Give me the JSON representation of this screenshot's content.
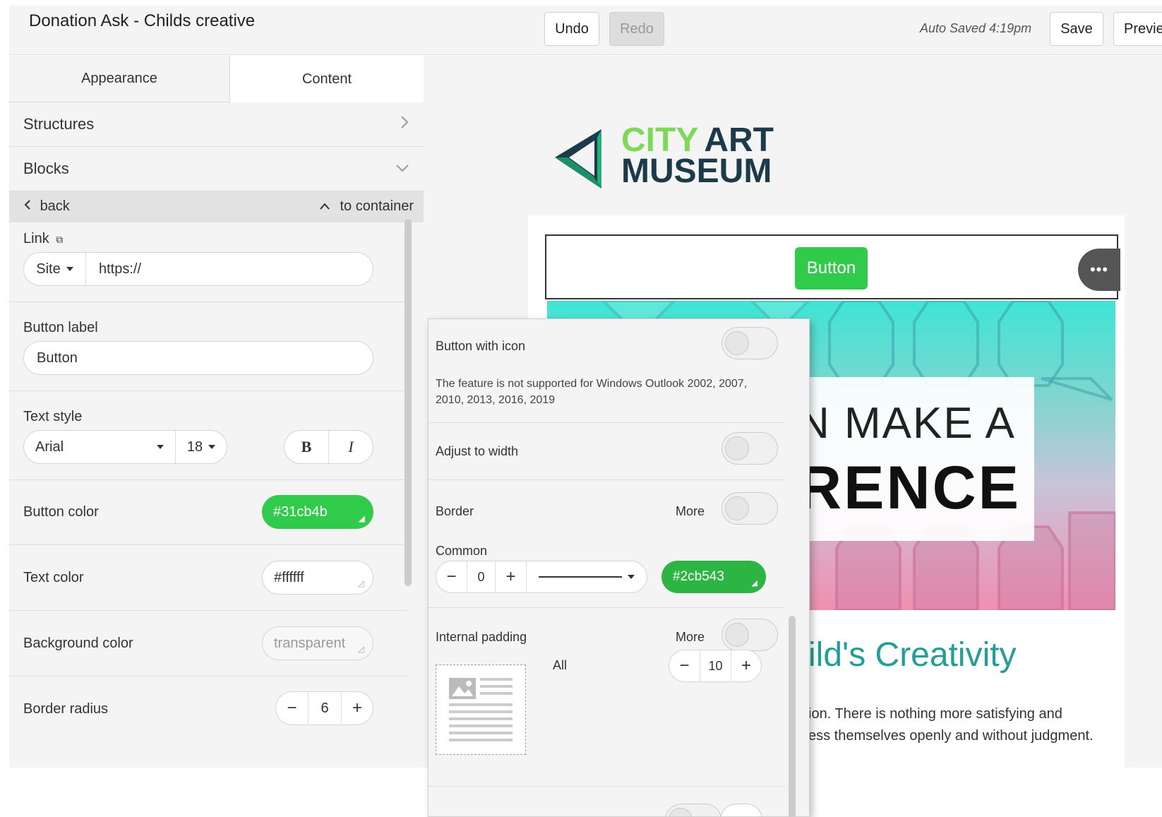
{
  "topbar": {
    "title": "Donation Ask - Childs creative",
    "undo": "Undo",
    "redo": "Redo",
    "autosaved": "Auto Saved 4:19pm",
    "save": "Save",
    "preview": "Previe"
  },
  "sidebar": {
    "tabs": [
      "Appearance",
      "Content"
    ],
    "active_tab": "Content",
    "sections": [
      {
        "label": "Structures",
        "icon": "chevron-right-icon"
      },
      {
        "label": "Blocks",
        "icon": "chevron-down-icon"
      }
    ],
    "back": "back",
    "to_container": "to container",
    "link": {
      "label": "Link",
      "type": "Site",
      "url": "https://"
    },
    "button_label": {
      "label": "Button label",
      "value": "Button"
    },
    "text_style": {
      "label": "Text style",
      "font": "Arial",
      "size": "18",
      "bold": "B",
      "italic": "I"
    },
    "button_color": {
      "label": "Button color",
      "value": "#31cb4b"
    },
    "text_color": {
      "label": "Text color",
      "value": "#ffffff"
    },
    "background_color": {
      "label": "Background color",
      "value": "transparent"
    },
    "border_radius": {
      "label": "Border radius",
      "value": "6",
      "minus": "−",
      "plus": "+"
    }
  },
  "canvas": {
    "logo_line1_a": "CITY",
    "logo_line1_b": "ART",
    "logo_line2": "MUSEUM",
    "button_text": "Button",
    "more": "•••",
    "hero_line1": "N MAKE A",
    "hero_line2": "RENCE",
    "headline": "ild's Creativity",
    "paragraph_line1": "ion. There is nothing more satisfying and",
    "paragraph_line2": "ess themselves openly and without judgment."
  },
  "popup": {
    "button_with_icon": "Button with icon",
    "icon_note": "The feature is not supported for Windows Outlook 2002, 2007, 2010, 2013, 2016, 2019",
    "adjust_to_width": "Adjust to width",
    "border": "Border",
    "more": "More",
    "common": "Common",
    "border_width": "0",
    "border_color": "#2cb543",
    "internal_padding": "Internal padding",
    "all": "All",
    "padding_value": "10",
    "minus": "−",
    "plus": "+"
  },
  "colors": {
    "button_green": "#31cb4b",
    "border_green": "#2cb543",
    "headline_teal": "#1f9f95"
  }
}
